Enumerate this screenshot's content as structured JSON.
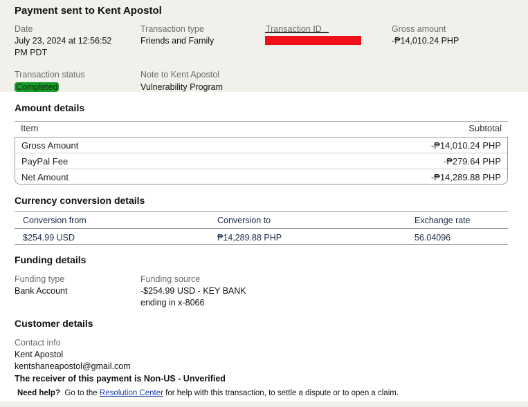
{
  "header": {
    "title": "Payment sent to Kent Apostol",
    "date_label": "Date",
    "date_value_line1": "July 23, 2024 at 12:56:52",
    "date_value_line2": "PM PDT",
    "type_label": "Transaction type",
    "type_value": "Friends and Family",
    "txid_label": "Transaction ID",
    "gross_label": "Gross amount",
    "gross_value": "-₱14,010.24 PHP",
    "status_label": "Transaction status",
    "status_value": "Completed",
    "note_label": "Note to Kent Apostol",
    "note_value": "Vulnerability Program"
  },
  "amount_details": {
    "heading": "Amount details",
    "col_item": "Item",
    "col_subtotal": "Subtotal",
    "rows": [
      {
        "item": "Gross Amount",
        "subtotal": "-₱14,010.24 PHP"
      },
      {
        "item": "PayPal Fee",
        "subtotal": "-₱279.64 PHP"
      },
      {
        "item": "Net Amount",
        "subtotal": "-₱14,289.88 PHP"
      }
    ]
  },
  "currency_conversion": {
    "heading": "Currency conversion details",
    "col_from": "Conversion from",
    "col_to": "Conversion to",
    "col_rate": "Exchange rate",
    "from": "$254.99 USD",
    "to": "₱14,289.88 PHP",
    "rate": "56.04096"
  },
  "funding": {
    "heading": "Funding details",
    "type_label": "Funding type",
    "type_value": "Bank Account",
    "source_label": "Funding source",
    "source_line1": "-$254.99 USD - KEY BANK",
    "source_line2": "ending in x-8066"
  },
  "customer": {
    "heading": "Customer details",
    "contact_label": "Contact info",
    "name": "Kent Apostol",
    "email": "kentshaneapostol@gmail.com",
    "warning": "The receiver of this payment is Non-US - Unverified"
  },
  "help": {
    "label": "Need help?",
    "text_before": "Go to the",
    "link": "Resolution Center",
    "text_after": "for help with this transaction, to settle a dispute or to open a claim."
  },
  "colors": {
    "header_bg": "#f2f0eb",
    "status_green": "#1a9c2a",
    "redaction_red": "#f0101a",
    "link_blue": "#1a3f9c"
  }
}
